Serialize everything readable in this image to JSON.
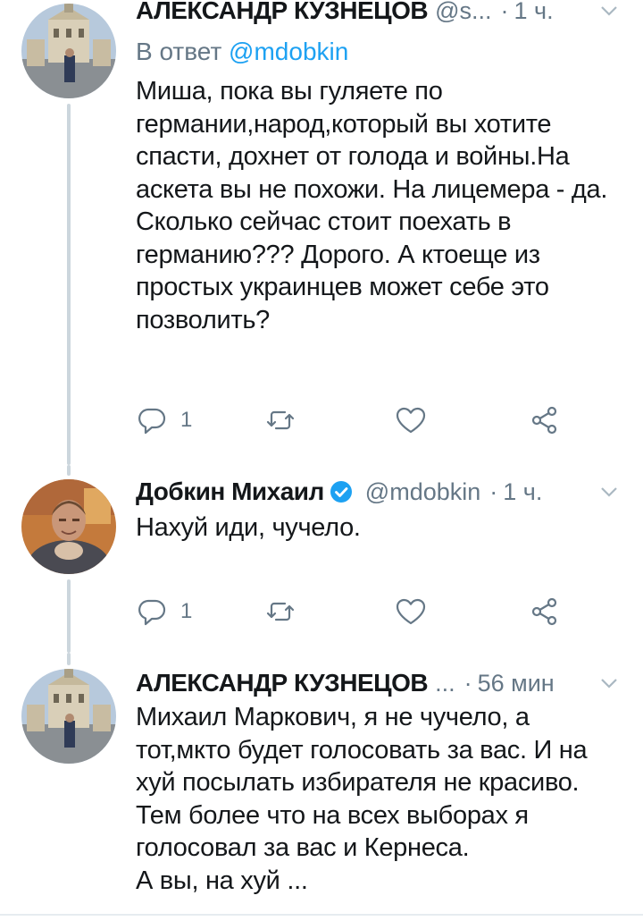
{
  "tweets": [
    {
      "author": "АЛЕКСАНДР КУЗНЕЦОВ",
      "handle": "@s...",
      "dot": "·",
      "time": "1 ч.",
      "reply_prefix": "В ответ",
      "reply_handle": "@mdobkin",
      "lines": [
        "Миша, пока вы гуляете по германии,народ,который вы хотите спасти, дохнет от голода и войны.На аскета вы не похожи. На лицемера - да.",
        "Сколько сейчас стоит поехать в германию??? Дорого. А ктоеще из простых украинцев может себе это позволить?"
      ],
      "reply_count": "1"
    },
    {
      "author": "Добкин Михаил",
      "handle": "@mdobkin",
      "dot": "·",
      "time": "1 ч.",
      "lines": [
        "Нахуй иди, чучело."
      ],
      "reply_count": "1"
    },
    {
      "author": "АЛЕКСАНДР КУЗНЕЦОВ",
      "handle": "...",
      "dot": "·",
      "time": "56 мин",
      "lines": [
        "Михаил Маркович, я не чучело, а тот,мкто будет голосовать за вас. И на хуй посылать избирателя не красиво.",
        "Тем более что на всех выборах я голосовал за вас и Кернеса.",
        "А вы, на хуй ..."
      ]
    }
  ],
  "icons": {
    "reply": "reply-icon",
    "retweet": "retweet-icon",
    "like": "heart-icon",
    "share": "share-icon",
    "verified": "verified-badge-icon",
    "caret": "chevron-down-icon"
  },
  "colors": {
    "text": "#14171a",
    "muted": "#657786",
    "link": "#1da1f2",
    "thread_line": "#ccd6dd"
  }
}
